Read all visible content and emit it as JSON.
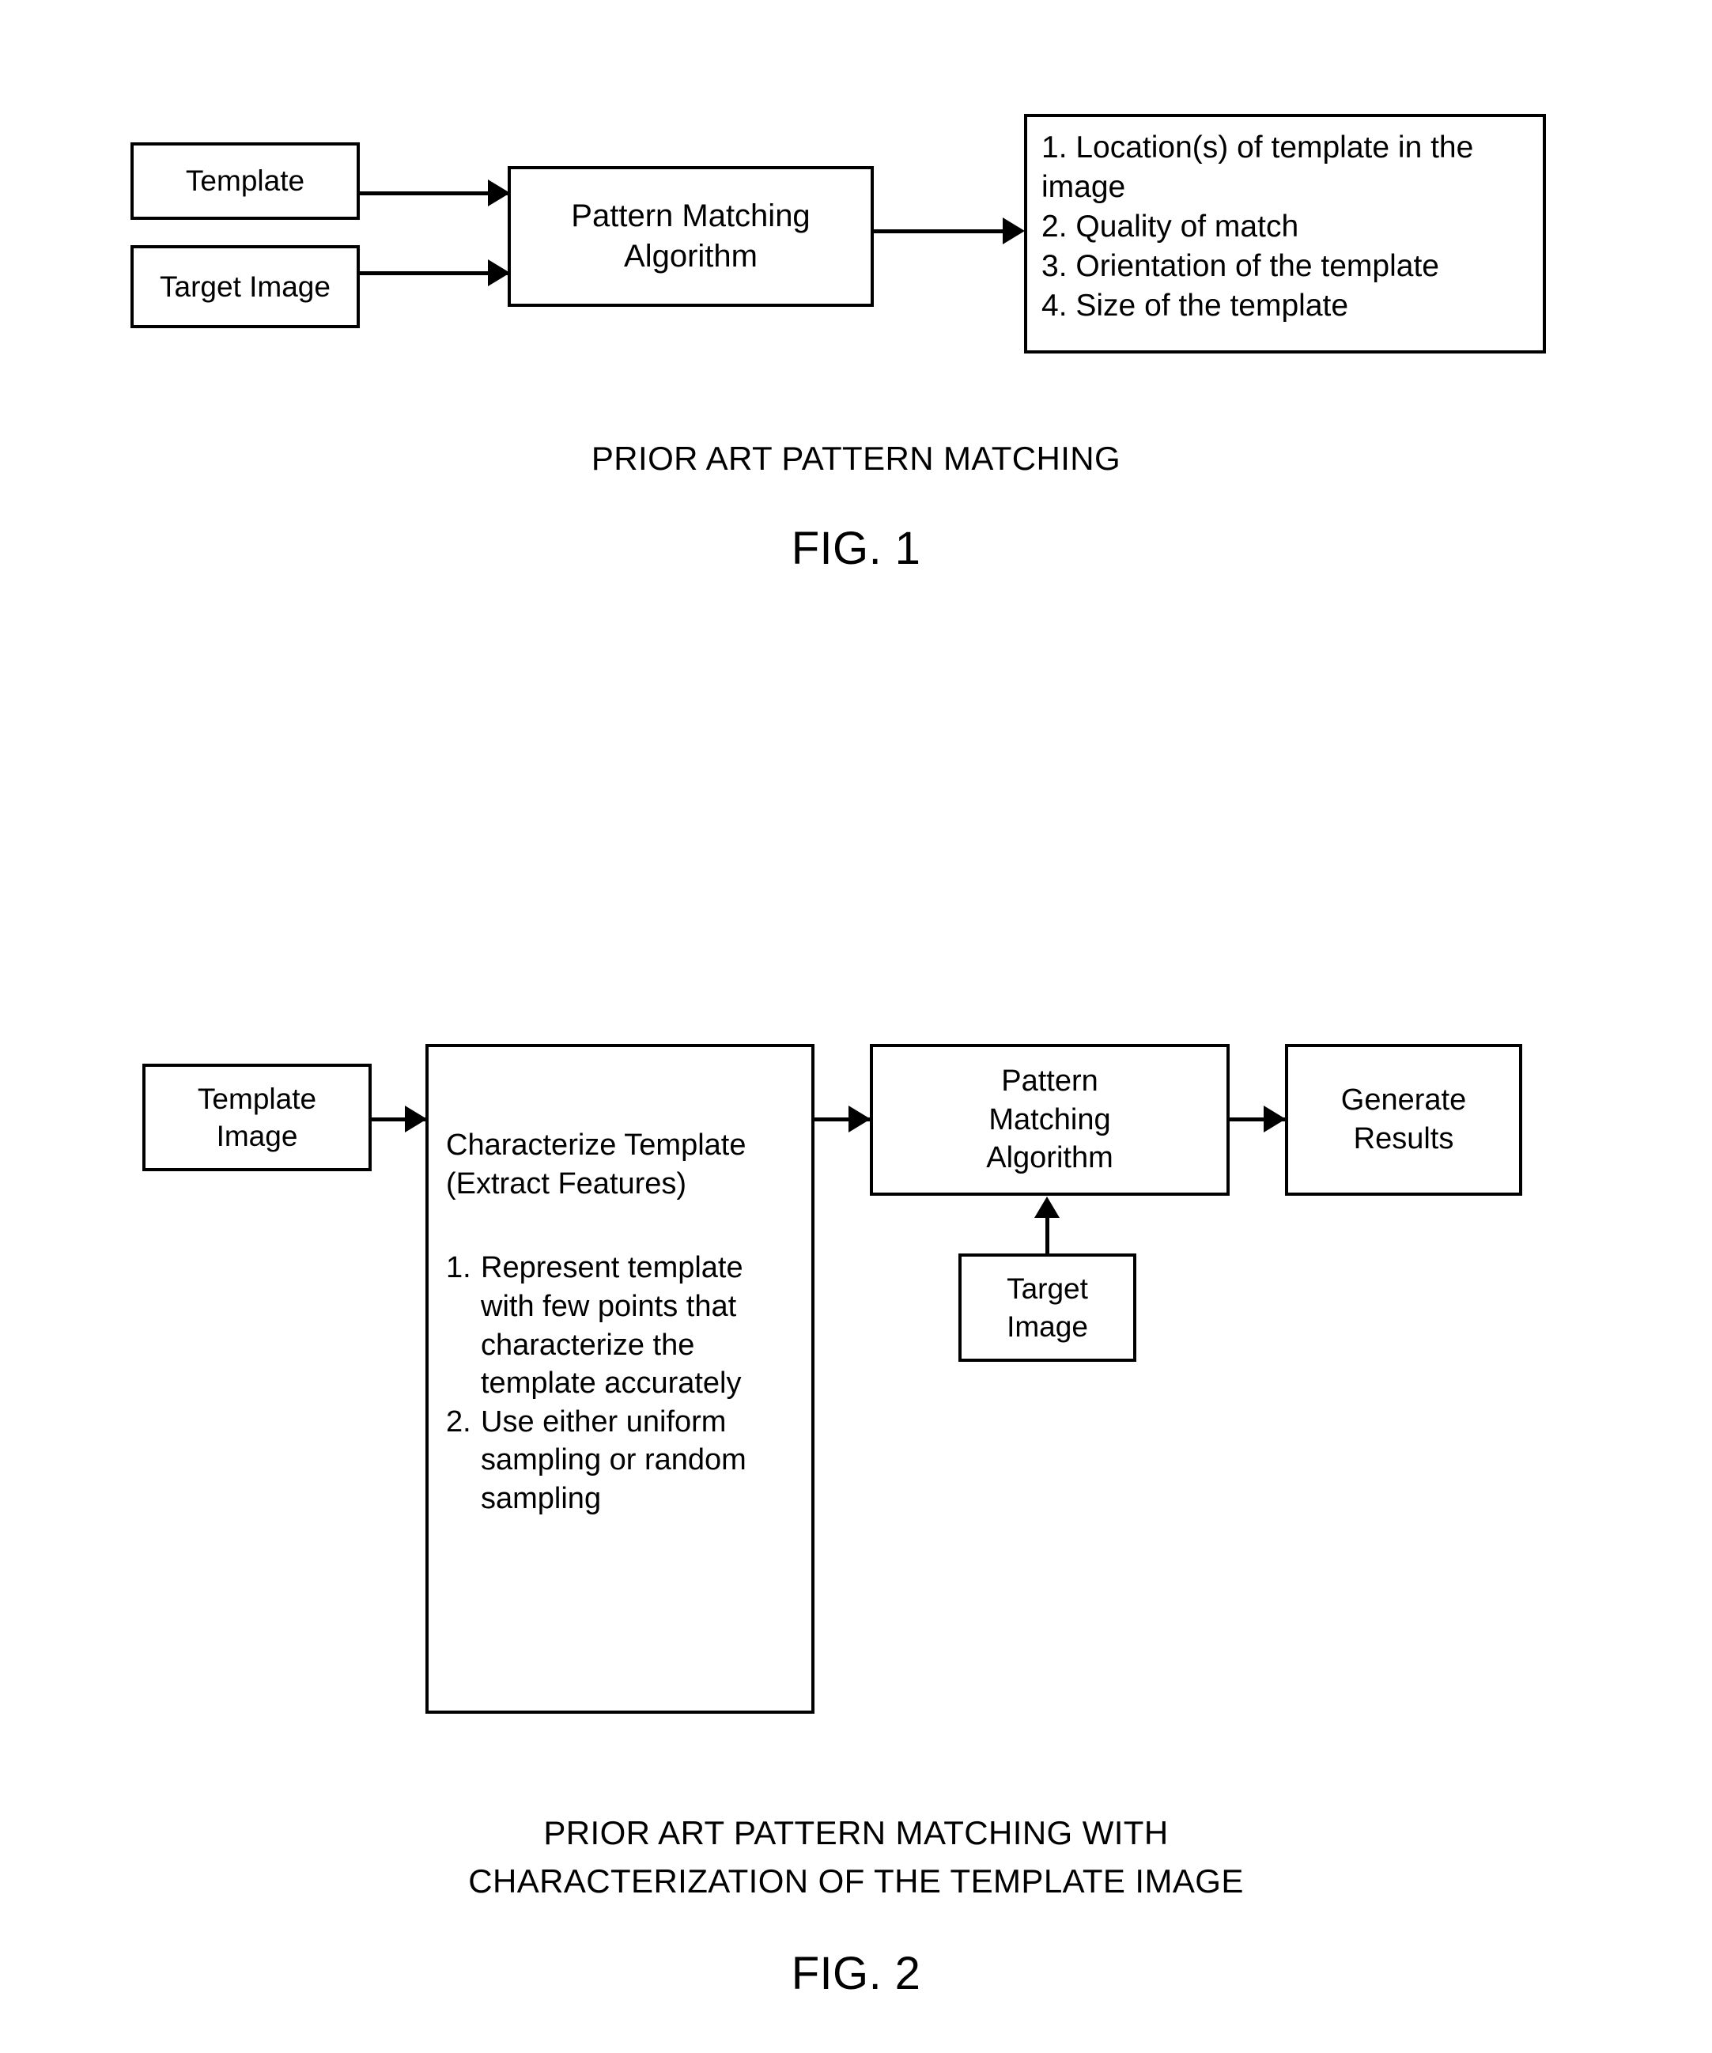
{
  "figure1": {
    "template_box": "Template",
    "target_box": "Target Image",
    "algorithm_box": "Pattern  Matching\nAlgorithm",
    "results": [
      "1. Location(s) of template in the image",
      "2. Quality of match",
      "3. Orientation of the template",
      "4. Size of the template"
    ],
    "caption_main": "PRIOR ART PATTERN MATCHING",
    "caption_number": "FIG. 1"
  },
  "figure2": {
    "template_image_box": "Template\nImage",
    "characterize_title": "Characterize Template\n(Extract Features)",
    "characterize_items": [
      {
        "num": "1.",
        "text": "Represent template with few points that characterize the template accurately"
      },
      {
        "num": "2.",
        "text": "Use either uniform sampling or random sampling"
      }
    ],
    "pattern_matching_box": "Pattern\nMatching\nAlgorithm",
    "generate_results_box": "Generate\nResults",
    "target_image_box": "Target\nImage",
    "caption_main": "PRIOR ART PATTERN MATCHING WITH\nCHARACTERIZATION OF THE TEMPLATE IMAGE",
    "caption_number": "FIG. 2"
  },
  "colors": {
    "ink": "#000000",
    "paper": "#ffffff"
  }
}
